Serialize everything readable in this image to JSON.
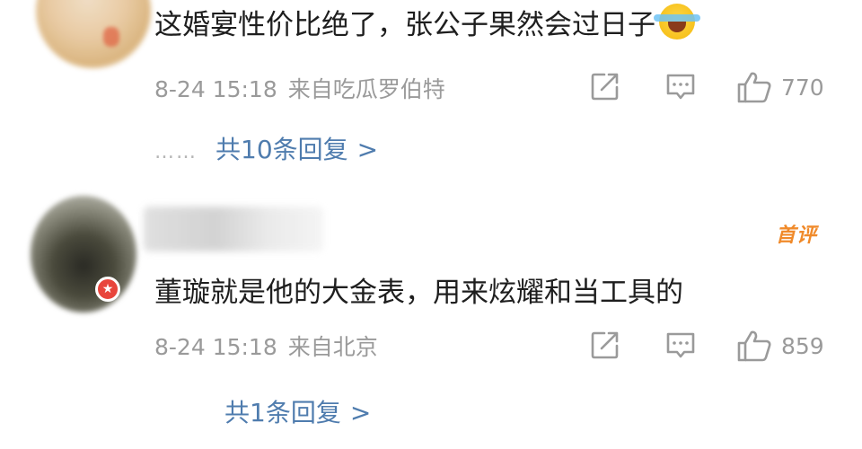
{
  "comments": [
    {
      "text": "这婚宴性价比绝了，张公子果然会过日子",
      "emoji": "laughing-crying-emoji",
      "date": "8-24 15:18",
      "source": "来自吃瓜罗伯特",
      "likes": "770",
      "replies_dots": "……",
      "replies_label": "共10条回复",
      "replies_chevron": ">"
    },
    {
      "username": "",
      "tag": "首评",
      "text": "董璇就是他的大金表，用来炫耀和当工具的",
      "date": "8-24 15:18",
      "source": "来自北京",
      "likes": "859",
      "replies_label": "共1条回复",
      "replies_chevron": ">"
    }
  ],
  "colors": {
    "link": "#4f7cae",
    "meta": "#9a9a9a",
    "first_comment_tag": "#f08a2a",
    "vip_badge": "#e8453c"
  },
  "icons": [
    "share-icon",
    "comment-icon",
    "thumbs-up-icon",
    "vip-star-icon"
  ]
}
